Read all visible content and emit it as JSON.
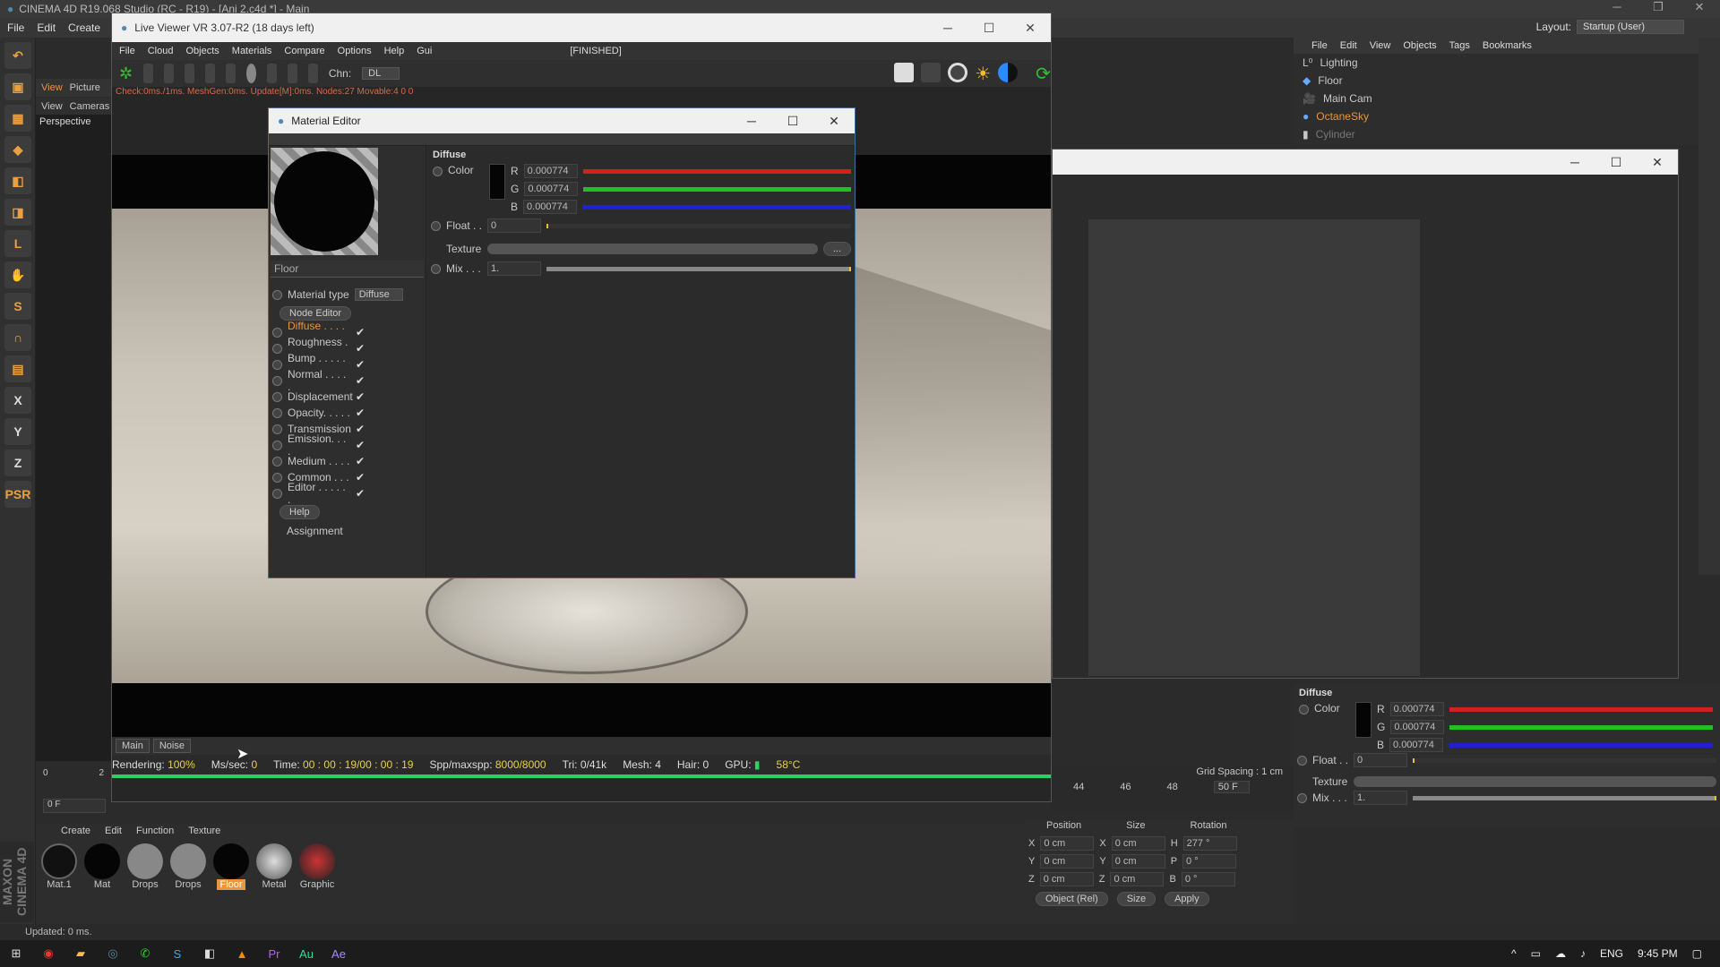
{
  "app": {
    "title": "CINEMA 4D R19.068 Studio (RC - R19) - [Ani 2.c4d *] - Main",
    "menu": [
      "File",
      "Edit",
      "Create"
    ],
    "layout_label": "Layout:",
    "layout_value": "Startup (User)"
  },
  "live_viewer": {
    "title": "Live Viewer VR 3.07-R2 (18 days left)",
    "menu": [
      "File",
      "Cloud",
      "Objects",
      "Materials",
      "Compare",
      "Options",
      "Help",
      "Gui"
    ],
    "state": "[FINISHED]",
    "chn_label": "Chn:",
    "chn_value": "DL",
    "status_line": "Check:0ms./1ms. MeshGen:0ms. Update[M]:0ms. Nodes:27 Movable:4  0 0",
    "tabs": [
      "Main",
      "Noise"
    ],
    "render": {
      "rendering_label": "Rendering:",
      "rendering_value": "100%",
      "mssec_label": "Ms/sec:",
      "mssec_value": "0",
      "time_label": "Time:",
      "time_value": "00 : 00 : 19/00 : 00 : 19",
      "spp_label": "Spp/maxspp:",
      "spp_value": "8000/8000",
      "tri": "Tri: 0/41k",
      "mesh": "Mesh: 4",
      "hair": "Hair: 0",
      "gpu_label": "GPU:",
      "gpu_temp": "58°C"
    }
  },
  "viewport": {
    "menu": [
      "View",
      "Cameras"
    ],
    "label": "Perspective",
    "tabs": [
      "View",
      "Picture"
    ]
  },
  "material_editor": {
    "title": "Material Editor",
    "material_name": "Floor",
    "material_type_label": "Material type",
    "material_type_value": "Diffuse",
    "node_editor": "Node Editor",
    "help": "Help",
    "assignment": "Assignment",
    "channels": [
      {
        "label": "Diffuse . . . . .",
        "active": true
      },
      {
        "label": "Roughness . .",
        "active": false
      },
      {
        "label": "Bump . . . . . .",
        "active": false
      },
      {
        "label": "Normal . . . . .",
        "active": false
      },
      {
        "label": "Displacement",
        "active": false
      },
      {
        "label": "Opacity. . . . .",
        "active": false
      },
      {
        "label": "Transmission",
        "active": false
      },
      {
        "label": "Emission. . . .",
        "active": false
      },
      {
        "label": "Medium . . . .",
        "active": false
      },
      {
        "label": "Common . . .",
        "active": false
      },
      {
        "label": "Editor . . . . . .",
        "active": false
      }
    ],
    "check": "✔",
    "diffuse": {
      "section": "Diffuse",
      "color_label": "Color",
      "r_label": "R",
      "g_label": "G",
      "b_label": "B",
      "r": "0.000774",
      "g": "0.000774",
      "b": "0.000774",
      "float_label": "Float . .",
      "float_value": "0",
      "texture_label": "Texture",
      "texture_btn": "...",
      "mix_label": "Mix . . .",
      "mix_value": "1."
    }
  },
  "object_manager": {
    "menu": [
      "File",
      "Edit",
      "View",
      "Objects",
      "Tags",
      "Bookmarks"
    ],
    "objects": [
      "Lighting",
      "Floor",
      "Main Cam",
      "OctaneSky",
      "Cylinder"
    ]
  },
  "attributes": {
    "section": "Diffuse",
    "color_label": "Color",
    "r_label": "R",
    "g_label": "G",
    "b_label": "B",
    "r": "0.000774",
    "g": "0.000774",
    "b": "0.000774",
    "float_label": "Float . .",
    "float_value": "0",
    "texture_label": "Texture",
    "mix_label": "Mix . . .",
    "mix_value": "1."
  },
  "timeline": {
    "ticks": [
      "44",
      "46",
      "48"
    ],
    "frame": "50 F",
    "grid_spacing": "Grid Spacing : 1 cm",
    "start_frame": "0 F",
    "left_ticks": [
      "0",
      "2"
    ]
  },
  "coords": {
    "headers": [
      "Position",
      "Size",
      "Rotation"
    ],
    "rows": [
      [
        "X",
        "0 cm",
        "X",
        "0 cm",
        "H",
        "277 °"
      ],
      [
        "Y",
        "0 cm",
        "Y",
        "0 cm",
        "P",
        "0 °"
      ],
      [
        "Z",
        "0 cm",
        "Z",
        "0 cm",
        "B",
        "0 °"
      ]
    ],
    "mode1": "Object (Rel)",
    "mode2": "Size",
    "apply": "Apply"
  },
  "material_bar": {
    "menu": [
      "Create",
      "Edit",
      "Function",
      "Texture"
    ],
    "materials": [
      "Mat.1",
      "Mat",
      "Drops",
      "Drops",
      "Floor",
      "Metal",
      "Graphic"
    ]
  },
  "maxon": "MAXON CINEMA 4D",
  "status": "Updated: 0 ms.",
  "taskbar": {
    "lang": "ENG",
    "time": "9:45 PM"
  },
  "colors": {
    "accent": "#e89640",
    "progress": "#30d060",
    "r": "#d02020",
    "g": "#20c020",
    "b": "#2020d0"
  }
}
